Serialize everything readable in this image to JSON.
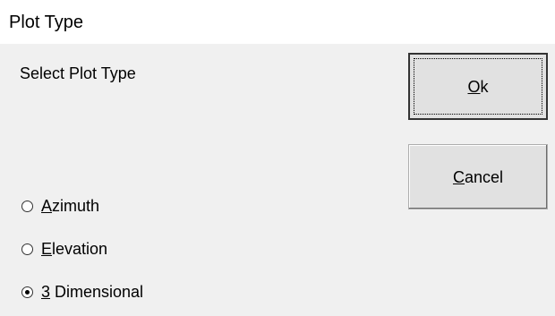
{
  "window": {
    "title": "Plot Type"
  },
  "dialog": {
    "prompt": "Select Plot Type",
    "ok_button": {
      "mnemonic": "O",
      "rest": "k"
    },
    "cancel_button": {
      "mnemonic": "C",
      "rest": "ancel"
    },
    "options": [
      {
        "mnemonic": "A",
        "rest": "zimuth",
        "checked": false
      },
      {
        "mnemonic": "E",
        "rest": "levation",
        "checked": false
      },
      {
        "mnemonic": "3",
        "rest": " Dimensional",
        "checked": true
      }
    ],
    "selected_option": "3 Dimensional"
  }
}
